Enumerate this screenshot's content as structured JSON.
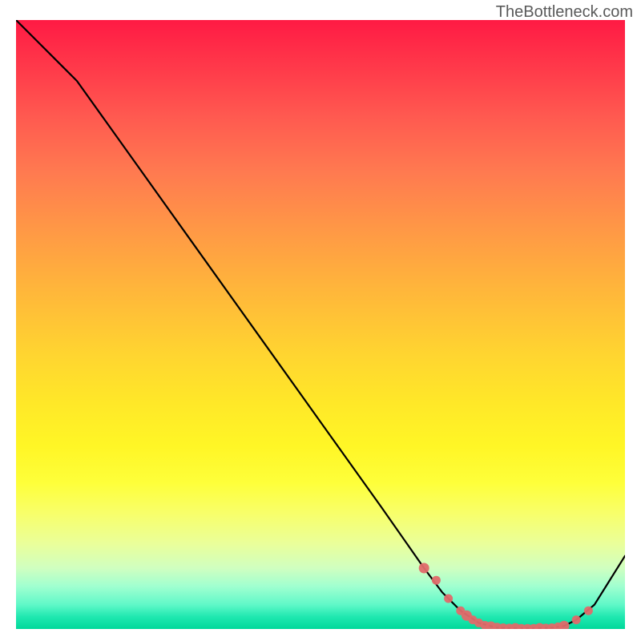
{
  "watermark": "TheBottleneck.com",
  "chart_data": {
    "type": "line",
    "title": "",
    "xlabel": "",
    "ylabel": "",
    "xlim": [
      0,
      100
    ],
    "ylim": [
      0,
      100
    ],
    "grid": false,
    "series": [
      {
        "name": "curve",
        "color": "#000000",
        "x": [
          0,
          4,
          7,
          10,
          20,
          30,
          40,
          50,
          60,
          67,
          70,
          73,
          76,
          79,
          82,
          85,
          88,
          90,
          92,
          95,
          100
        ],
        "values": [
          100,
          96,
          93,
          90,
          76,
          62,
          48,
          34,
          20,
          10,
          6,
          3,
          1,
          0.2,
          0.1,
          0.1,
          0.2,
          0.5,
          1.5,
          4,
          12
        ]
      },
      {
        "name": "markers",
        "color": "#e06a6a",
        "marker_only": true,
        "x": [
          67,
          69,
          71,
          73,
          74,
          75,
          76,
          77,
          78,
          79,
          80,
          81,
          82,
          83,
          84,
          85,
          86,
          87,
          88,
          89,
          90,
          92,
          94
        ],
        "values": [
          10,
          8,
          5,
          3,
          2.2,
          1.5,
          1,
          0.6,
          0.4,
          0.3,
          0.2,
          0.15,
          0.12,
          0.1,
          0.1,
          0.1,
          0.12,
          0.15,
          0.2,
          0.35,
          0.5,
          1.5,
          3
        ]
      }
    ],
    "background_gradient": {
      "direction": "vertical",
      "stops": [
        {
          "pos": 0.0,
          "color": "#ff1a44"
        },
        {
          "pos": 0.25,
          "color": "#ff7a50"
        },
        {
          "pos": 0.55,
          "color": "#ffd530"
        },
        {
          "pos": 0.76,
          "color": "#feff3a"
        },
        {
          "pos": 0.9,
          "color": "#d0ffc0"
        },
        {
          "pos": 1.0,
          "color": "#00d89a"
        }
      ]
    }
  }
}
